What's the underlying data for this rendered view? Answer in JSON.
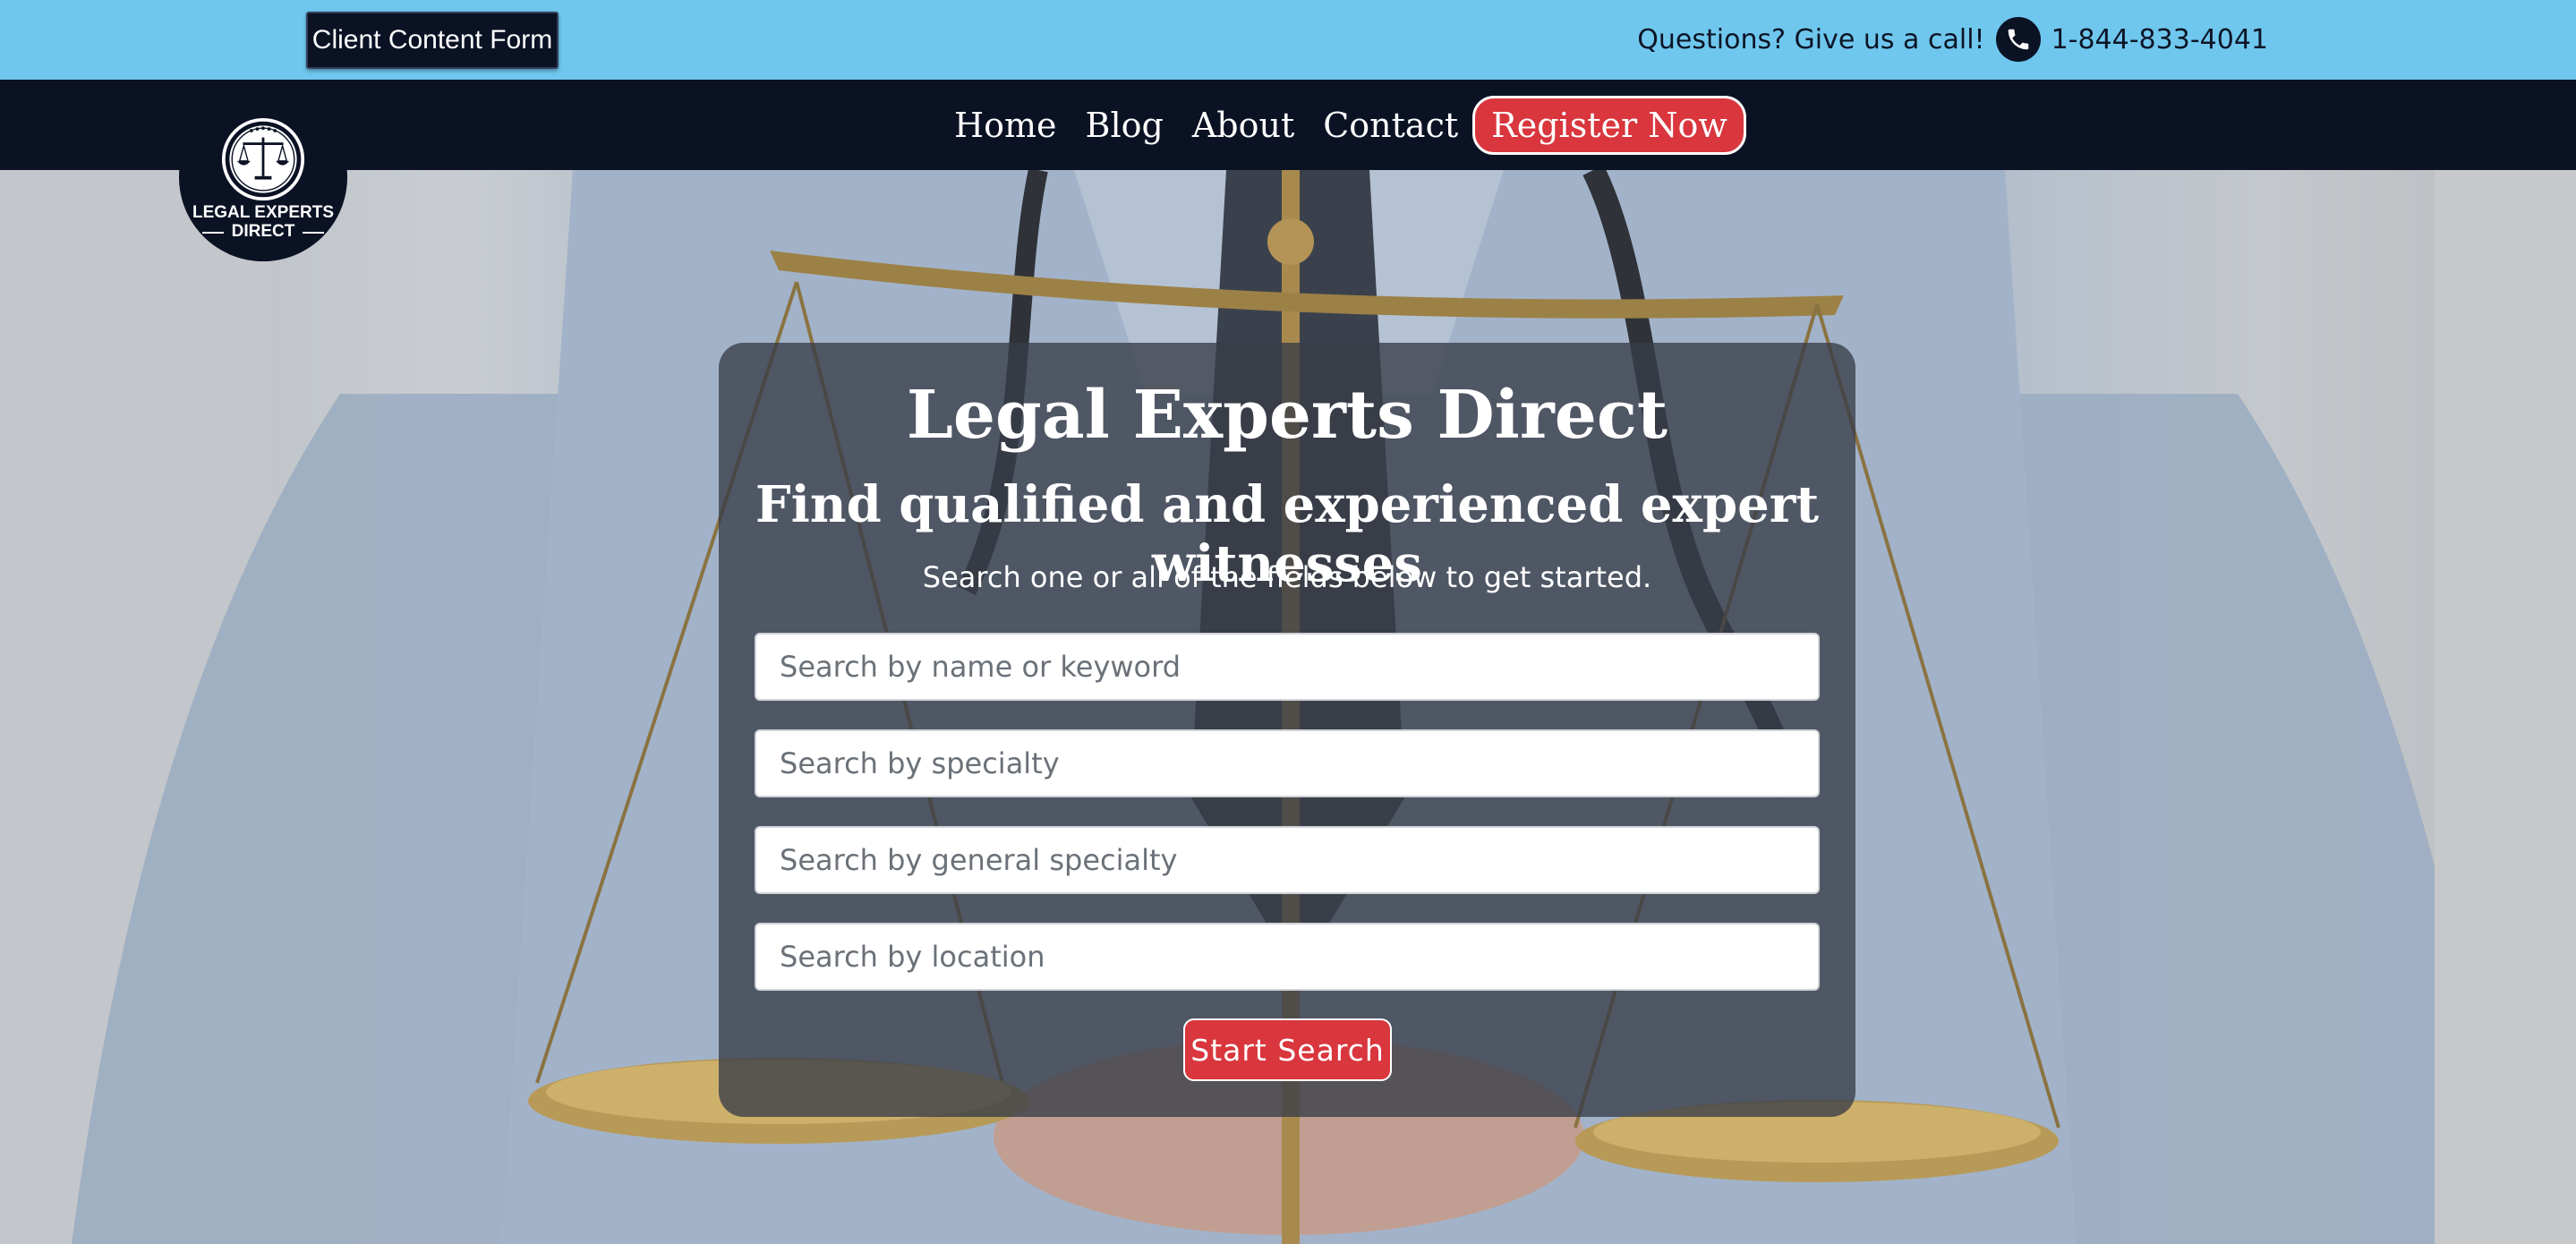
{
  "topbar": {
    "client_form_label": "Client Content Form",
    "questions_text": "Questions? Give us a call!",
    "phone_number": "1-844-833-4041"
  },
  "nav": {
    "items": [
      {
        "label": "Home"
      },
      {
        "label": "Blog"
      },
      {
        "label": "About"
      },
      {
        "label": "Contact"
      }
    ],
    "register_label": "Register Now"
  },
  "logo": {
    "line1": "LEGAL EXPERTS",
    "line2": "DIRECT"
  },
  "hero": {
    "title": "Legal Experts Direct",
    "subtitle": "Find qualified and experienced expert witnesses",
    "instructions": "Search one or all of the fields below to get started.",
    "fields": {
      "name_placeholder": "Search by name or keyword",
      "specialty_placeholder": "Search by specialty",
      "general_specialty_placeholder": "Search by general specialty",
      "location_placeholder": "Search by location"
    },
    "search_button_label": "Start Search"
  },
  "colors": {
    "topbar_bg": "#6fc7ee",
    "navy": "#0b1224",
    "accent_red": "#d9363e"
  },
  "icons": {
    "phone": "phone-icon",
    "logo_emblem": "scales-of-justice-icon"
  }
}
